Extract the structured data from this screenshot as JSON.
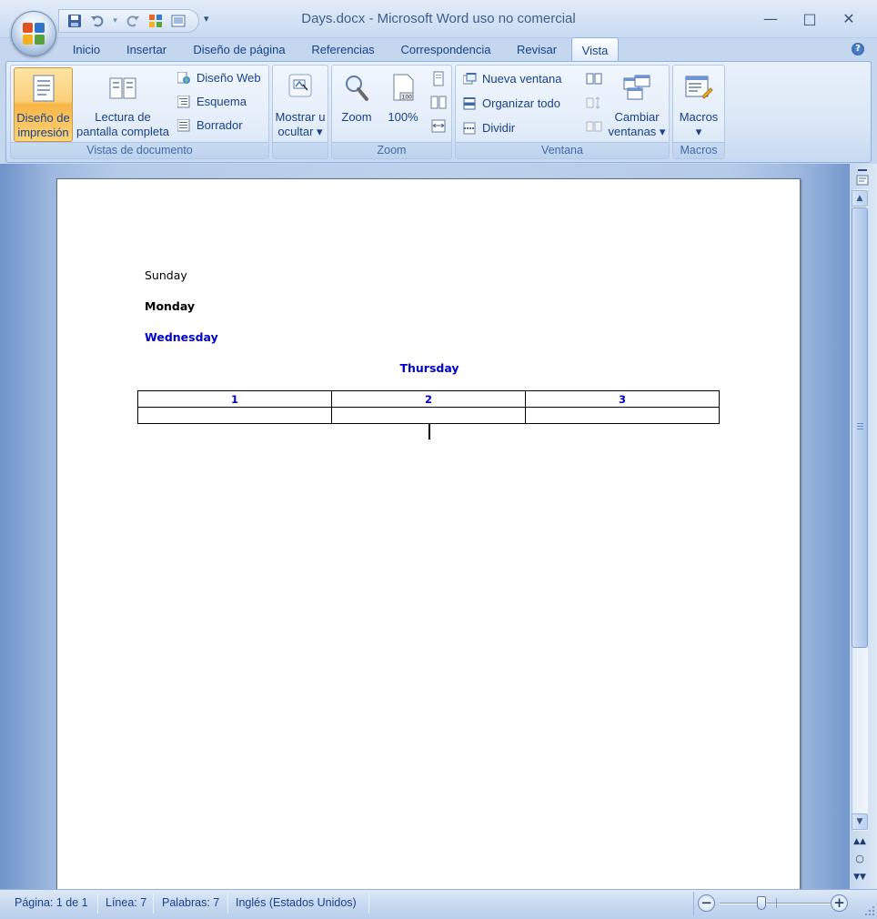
{
  "window": {
    "title": "Days.docx - Microsoft Word uso no comercial",
    "controls": {
      "minimize": "—",
      "maximize": "□",
      "close": "✕"
    }
  },
  "qat": {
    "icons": [
      "save-icon",
      "undo-icon",
      "redo-icon",
      "apps-icon",
      "print-preview-icon",
      "customize-icon"
    ]
  },
  "tabs": [
    {
      "label": "Inicio",
      "active": false
    },
    {
      "label": "Insertar",
      "active": false
    },
    {
      "label": "Diseño de página",
      "active": false
    },
    {
      "label": "Referencias",
      "active": false
    },
    {
      "label": "Correspondencia",
      "active": false
    },
    {
      "label": "Revisar",
      "active": false
    },
    {
      "label": "Vista",
      "active": true
    }
  ],
  "ribbon": {
    "vistas": {
      "label": "Vistas de documento",
      "print_layout": "Diseño de\nimpresión",
      "full_screen": "Lectura de\npantalla completa",
      "web": "Diseño Web",
      "outline": "Esquema",
      "draft": "Borrador"
    },
    "show": {
      "label": "Mostrar u\nocultar ▾"
    },
    "zoom": {
      "label": "Zoom",
      "zoom_btn": "Zoom",
      "hundred": "100%"
    },
    "ventana": {
      "label": "Ventana",
      "new_window": "Nueva ventana",
      "arrange_all": "Organizar todo",
      "split": "Dividir",
      "switch": "Cambiar\nventanas ▾"
    },
    "macros": {
      "label": "Macros",
      "btn": "Macros\n▾"
    }
  },
  "document": {
    "paragraphs": [
      {
        "text": "Sunday",
        "style": "normal"
      },
      {
        "text": "Monday",
        "style": "bold"
      },
      {
        "text": "Wednesday",
        "style": "bold-blue"
      },
      {
        "text": "Thursday",
        "style": "bold-blue-center"
      }
    ],
    "table": {
      "header": [
        "1",
        "2",
        "3"
      ],
      "rows": [
        [
          "",
          "",
          ""
        ]
      ]
    }
  },
  "status": {
    "page": "Página: 1 de 1",
    "line": "Línea: 7",
    "words": "Palabras: 7",
    "language": "Inglés (Estados Unidos)"
  },
  "zoom": {
    "minus": "−",
    "plus": "+"
  },
  "colors": {
    "accent": "#15428b",
    "active_button": "#fbd07a",
    "doc_blue_text": "#0000cc"
  }
}
